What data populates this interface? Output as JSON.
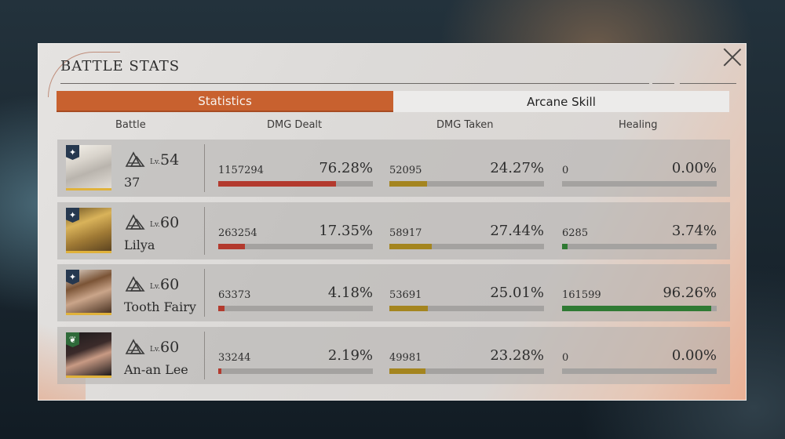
{
  "dialog": {
    "title": "BATTLE STATS"
  },
  "tabs": [
    {
      "label": "Statistics",
      "active": true
    },
    {
      "label": "Arcane Skill",
      "active": false
    }
  ],
  "columns": {
    "battle": "Battle",
    "dmg_dealt": "DMG Dealt",
    "dmg_taken": "DMG Taken",
    "healing": "Healing"
  },
  "colors": {
    "accent": "#c8612f",
    "dealt_bar": "#b33a2e",
    "taken_bar": "#a4851f",
    "healing_bar": "#2f7a33"
  },
  "characters": [
    {
      "lv_prefix": "Lv.",
      "level": "54",
      "name": "37",
      "element": "star-icon",
      "dealt": {
        "value": "1157294",
        "percent": "76.28%",
        "fraction": 0.7628
      },
      "taken": {
        "value": "52095",
        "percent": "24.27%",
        "fraction": 0.2427
      },
      "healing": {
        "value": "0",
        "percent": "0.00%",
        "fraction": 0.0
      }
    },
    {
      "lv_prefix": "Lv.",
      "level": "60",
      "name": "Lilya",
      "element": "star-icon",
      "dealt": {
        "value": "263254",
        "percent": "17.35%",
        "fraction": 0.1735
      },
      "taken": {
        "value": "58917",
        "percent": "27.44%",
        "fraction": 0.2744
      },
      "healing": {
        "value": "6285",
        "percent": "3.74%",
        "fraction": 0.0374
      }
    },
    {
      "lv_prefix": "Lv.",
      "level": "60",
      "name": "Tooth Fairy",
      "element": "star-icon",
      "dealt": {
        "value": "63373",
        "percent": "4.18%",
        "fraction": 0.0418
      },
      "taken": {
        "value": "53691",
        "percent": "25.01%",
        "fraction": 0.2501
      },
      "healing": {
        "value": "161599",
        "percent": "96.26%",
        "fraction": 0.9626
      }
    },
    {
      "lv_prefix": "Lv.",
      "level": "60",
      "name": "An-an Lee",
      "element": "leaf-icon",
      "dealt": {
        "value": "33244",
        "percent": "2.19%",
        "fraction": 0.0219
      },
      "taken": {
        "value": "49981",
        "percent": "23.28%",
        "fraction": 0.2328
      },
      "healing": {
        "value": "0",
        "percent": "0.00%",
        "fraction": 0.0
      }
    }
  ]
}
